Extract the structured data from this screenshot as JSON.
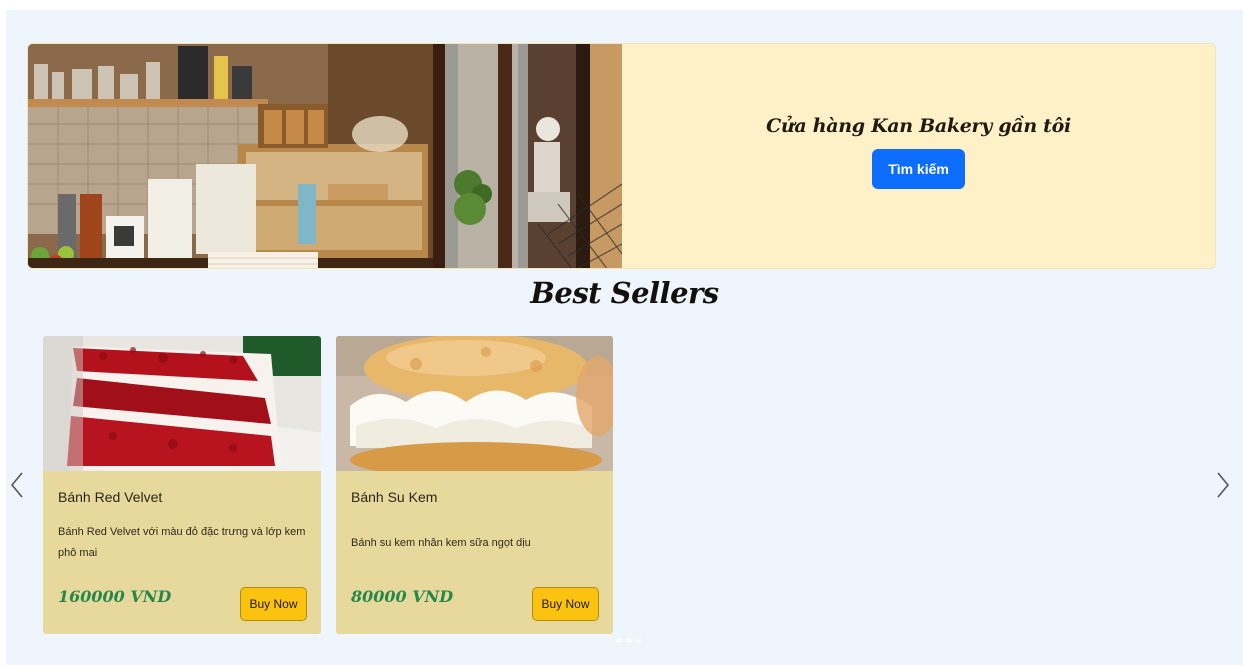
{
  "hero": {
    "title": "Cửa hàng Kan Bakery gần tôi",
    "button_label": "Tìm kiếm",
    "button_color": "#0d6efd",
    "panel_color": "#fef1c8"
  },
  "best_sellers": {
    "title": "Best Sellers",
    "products": [
      {
        "name": "Bánh Red Velvet",
        "description": "Bánh Red Velvet với màu đỏ đặc trưng và lớp kem phô mai",
        "price": "160000 VND",
        "buy_label": "Buy Now"
      },
      {
        "name": "Bánh Su Kem",
        "description": "Bánh su kem nhân kem sữa ngọt dịu",
        "price": "80000 VND",
        "buy_label": "Buy Now"
      }
    ]
  },
  "carousel": {
    "prev_icon": "chevron-left-icon",
    "next_icon": "chevron-right-icon"
  },
  "colors": {
    "card_bg": "#e7d99c",
    "price_green": "#25874b",
    "buy_button": "#fbc310",
    "page_bg": "#eef5fd"
  }
}
